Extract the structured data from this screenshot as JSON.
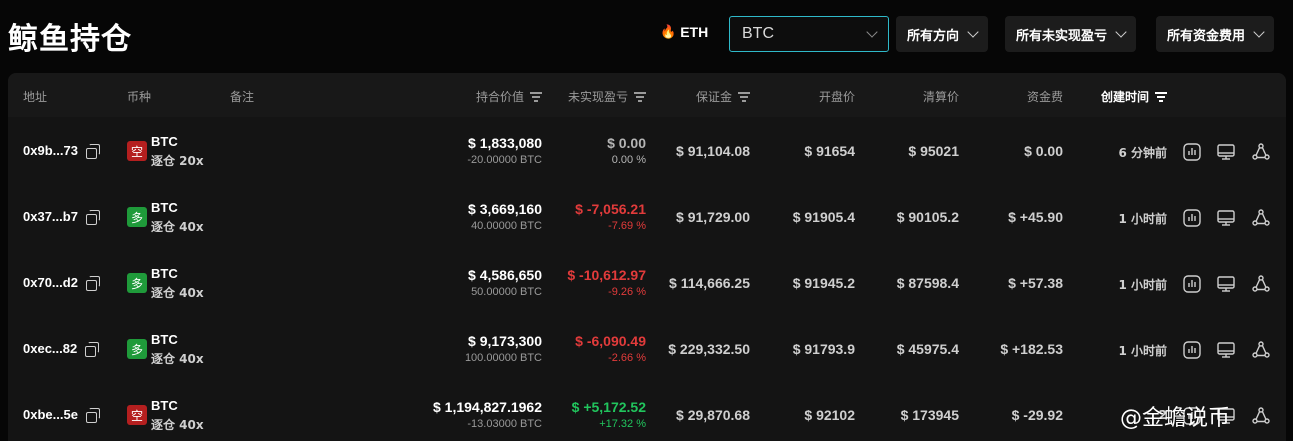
{
  "page": {
    "title": "鲸鱼持仓"
  },
  "filters": {
    "eth_label": "ETH",
    "search_value": "BTC",
    "direction": "所有方向",
    "pnl": "所有未实现盈亏",
    "funding": "所有资金费用"
  },
  "table": {
    "headers": {
      "address": "地址",
      "coin": "币种",
      "note": "备注",
      "value": "持合价值",
      "upnl": "未实现盈亏",
      "margin": "保证金",
      "entry": "开盘价",
      "liq": "清算价",
      "funding": "资金费",
      "created": "创建时间"
    },
    "rows": [
      {
        "address": "0x9b...73",
        "side": "空",
        "coin": "BTC",
        "leverage": "逐仓 20x",
        "value": "$ 1,833,080",
        "size": "-20.00000 BTC",
        "upnl": "$ 0.00",
        "upnl_pct": "0.00 %",
        "margin": "$ 91,104.08",
        "entry": "$ 91654",
        "liq": "$ 95021",
        "funding": "$ 0.00",
        "created": "6 分钟前"
      },
      {
        "address": "0x37...b7",
        "side": "多",
        "coin": "BTC",
        "leverage": "逐仓 40x",
        "value": "$ 3,669,160",
        "size": "40.00000 BTC",
        "upnl": "$ -7,056.21",
        "upnl_pct": "-7.69 %",
        "margin": "$ 91,729.00",
        "entry": "$ 91905.4",
        "liq": "$ 90105.2",
        "funding": "$ +45.90",
        "created": "1 小时前"
      },
      {
        "address": "0x70...d2",
        "side": "多",
        "coin": "BTC",
        "leverage": "逐仓 40x",
        "value": "$ 4,586,650",
        "size": "50.00000 BTC",
        "upnl": "$ -10,612.97",
        "upnl_pct": "-9.26 %",
        "margin": "$ 114,666.25",
        "entry": "$ 91945.2",
        "liq": "$ 87598.4",
        "funding": "$ +57.38",
        "created": "1 小时前"
      },
      {
        "address": "0xec...82",
        "side": "多",
        "coin": "BTC",
        "leverage": "逐仓 40x",
        "value": "$ 9,173,300",
        "size": "100.00000 BTC",
        "upnl": "$ -6,090.49",
        "upnl_pct": "-2.66 %",
        "margin": "$ 229,332.50",
        "entry": "$ 91793.9",
        "liq": "$ 45975.4",
        "funding": "$ +182.53",
        "created": "1 小时前"
      },
      {
        "address": "0xbe...5e",
        "side": "空",
        "coin": "BTC",
        "leverage": "逐仓 40x",
        "value": "$ 1,194,827.1962",
        "size": "-13.03000 BTC",
        "upnl": "$ +5,172.52",
        "upnl_pct": "+17.32 %",
        "margin": "$ 29,870.68",
        "entry": "$ 92102",
        "liq": "$ 173945",
        "funding": "$ -29.92",
        "created": "2"
      }
    ]
  },
  "watermark": "@金蟾说币",
  "colors": {
    "accent": "#2fb9c9",
    "long": "#1f9a3a",
    "short": "#b41f1f",
    "positive": "#21c55d",
    "negative": "#e23b3b"
  },
  "icons": {
    "row_actions": [
      "bar-chart-icon",
      "monitor-icon",
      "share-icon"
    ],
    "copy": "copy-icon",
    "eth": "fire-icon"
  }
}
